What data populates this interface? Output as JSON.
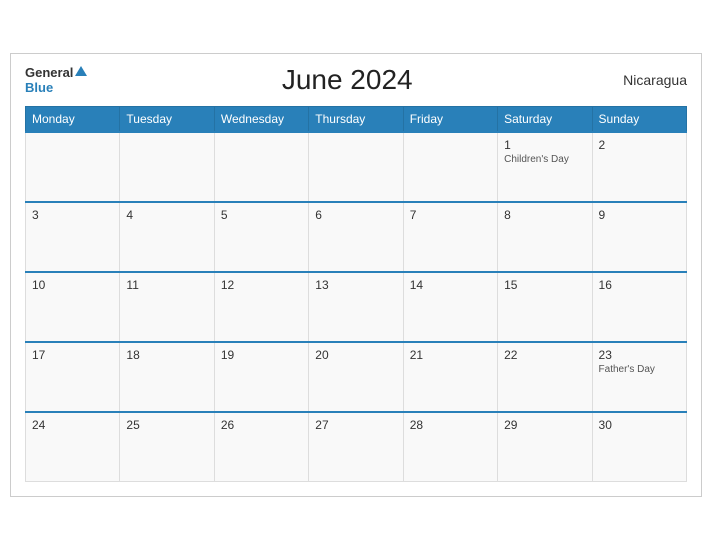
{
  "header": {
    "logo_general": "General",
    "logo_blue": "Blue",
    "title": "June 2024",
    "country": "Nicaragua"
  },
  "days_of_week": [
    "Monday",
    "Tuesday",
    "Wednesday",
    "Thursday",
    "Friday",
    "Saturday",
    "Sunday"
  ],
  "weeks": [
    [
      {
        "date": "",
        "event": ""
      },
      {
        "date": "",
        "event": ""
      },
      {
        "date": "",
        "event": ""
      },
      {
        "date": "",
        "event": ""
      },
      {
        "date": "",
        "event": ""
      },
      {
        "date": "1",
        "event": "Children's Day"
      },
      {
        "date": "2",
        "event": ""
      }
    ],
    [
      {
        "date": "3",
        "event": ""
      },
      {
        "date": "4",
        "event": ""
      },
      {
        "date": "5",
        "event": ""
      },
      {
        "date": "6",
        "event": ""
      },
      {
        "date": "7",
        "event": ""
      },
      {
        "date": "8",
        "event": ""
      },
      {
        "date": "9",
        "event": ""
      }
    ],
    [
      {
        "date": "10",
        "event": ""
      },
      {
        "date": "11",
        "event": ""
      },
      {
        "date": "12",
        "event": ""
      },
      {
        "date": "13",
        "event": ""
      },
      {
        "date": "14",
        "event": ""
      },
      {
        "date": "15",
        "event": ""
      },
      {
        "date": "16",
        "event": ""
      }
    ],
    [
      {
        "date": "17",
        "event": ""
      },
      {
        "date": "18",
        "event": ""
      },
      {
        "date": "19",
        "event": ""
      },
      {
        "date": "20",
        "event": ""
      },
      {
        "date": "21",
        "event": ""
      },
      {
        "date": "22",
        "event": ""
      },
      {
        "date": "23",
        "event": "Father's Day"
      }
    ],
    [
      {
        "date": "24",
        "event": ""
      },
      {
        "date": "25",
        "event": ""
      },
      {
        "date": "26",
        "event": ""
      },
      {
        "date": "27",
        "event": ""
      },
      {
        "date": "28",
        "event": ""
      },
      {
        "date": "29",
        "event": ""
      },
      {
        "date": "30",
        "event": ""
      }
    ]
  ]
}
